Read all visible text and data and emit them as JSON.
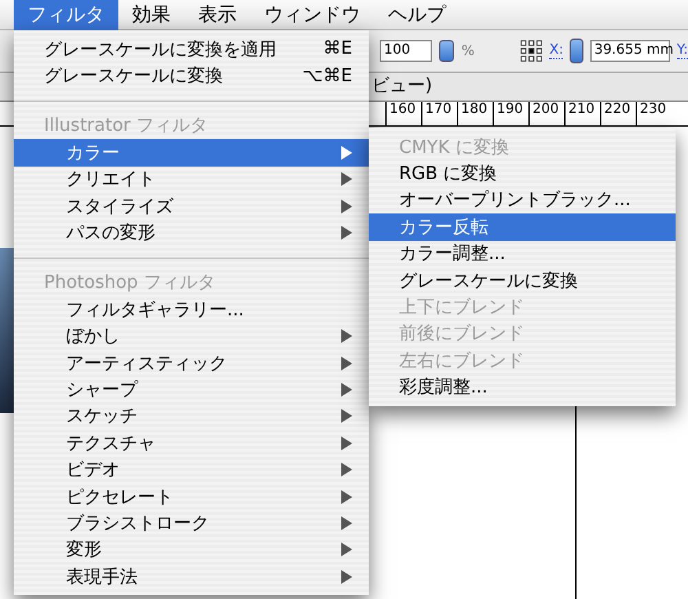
{
  "menubar": [
    {
      "label": "フィルタ",
      "selected": true
    },
    {
      "label": "効果",
      "selected": false
    },
    {
      "label": "表示",
      "selected": false
    },
    {
      "label": "ウィンドウ",
      "selected": false
    },
    {
      "label": "ヘルプ",
      "selected": false
    }
  ],
  "toolbar": {
    "opacity_value": "100",
    "percent": "%",
    "x_label": "X:",
    "x_value": "39.655 mm",
    "y_label": "Y:"
  },
  "document_title": "ビュー)",
  "ruler": [
    "160",
    "170",
    "180",
    "190",
    "200",
    "210",
    "220",
    "230"
  ],
  "menu": [
    {
      "kind": "command",
      "label": "グレースケールに変換を適用",
      "shortcut": "⌘E"
    },
    {
      "kind": "command",
      "label": "グレースケールに変換",
      "shortcut": "⌥⌘E"
    },
    {
      "kind": "separator"
    },
    {
      "kind": "header",
      "label": "Illustrator フィルタ"
    },
    {
      "kind": "submenu",
      "label": "カラー",
      "selected": true
    },
    {
      "kind": "submenu",
      "label": "クリエイト",
      "selected": false
    },
    {
      "kind": "submenu",
      "label": "スタイライズ",
      "selected": false
    },
    {
      "kind": "submenu",
      "label": "パスの変形",
      "selected": false
    },
    {
      "kind": "separator"
    },
    {
      "kind": "header",
      "label": "Photoshop フィルタ"
    },
    {
      "kind": "item",
      "label": "フィルタギャラリー...",
      "selected": false
    },
    {
      "kind": "submenu",
      "label": "ぼかし",
      "selected": false
    },
    {
      "kind": "submenu",
      "label": "アーティスティック",
      "selected": false
    },
    {
      "kind": "submenu",
      "label": "シャープ",
      "selected": false
    },
    {
      "kind": "submenu",
      "label": "スケッチ",
      "selected": false
    },
    {
      "kind": "submenu",
      "label": "テクスチャ",
      "selected": false
    },
    {
      "kind": "submenu",
      "label": "ビデオ",
      "selected": false
    },
    {
      "kind": "submenu",
      "label": "ピクセレート",
      "selected": false
    },
    {
      "kind": "submenu",
      "label": "ブラシストローク",
      "selected": false
    },
    {
      "kind": "submenu",
      "label": "変形",
      "selected": false
    },
    {
      "kind": "submenu",
      "label": "表現手法",
      "selected": false
    }
  ],
  "submenu": [
    {
      "label": "CMYK に変換",
      "disabled": true,
      "selected": false
    },
    {
      "label": "RGB に変換",
      "disabled": false,
      "selected": false
    },
    {
      "label": "オーバープリントブラック...",
      "disabled": false,
      "selected": false
    },
    {
      "label": "カラー反転",
      "disabled": false,
      "selected": true
    },
    {
      "label": "カラー調整...",
      "disabled": false,
      "selected": false
    },
    {
      "label": "グレースケールに変換",
      "disabled": false,
      "selected": false
    },
    {
      "label": "上下にブレンド",
      "disabled": true,
      "selected": false
    },
    {
      "label": "前後にブレンド",
      "disabled": true,
      "selected": false
    },
    {
      "label": "左右にブレンド",
      "disabled": true,
      "selected": false
    },
    {
      "label": "彩度調整...",
      "disabled": false,
      "selected": false
    }
  ]
}
